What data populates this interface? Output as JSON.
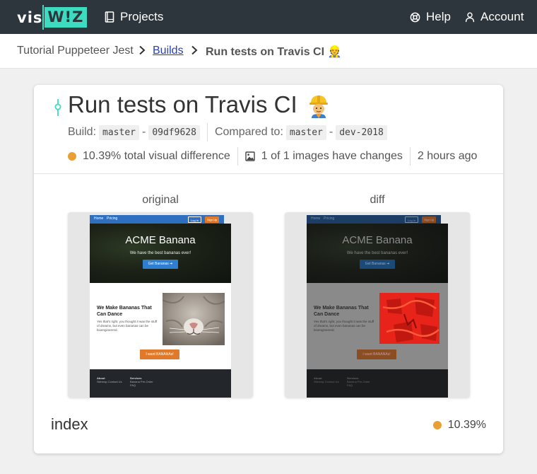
{
  "brand": {
    "vis": "vis",
    "wiz": "W!Z",
    "accent": "#3ddbc0",
    "nav_bg": "#2d363d"
  },
  "nav": {
    "projects_label": "Projects",
    "projects_icon": "book-icon",
    "help_label": "Help",
    "help_icon": "lifebuoy-icon",
    "account_label": "Account",
    "account_icon": "user-icon"
  },
  "breadcrumb": {
    "project": "Tutorial Puppeteer Jest",
    "separator": "›",
    "builds": "Builds",
    "current": "Run tests on Travis CI 👷"
  },
  "build": {
    "title": "Run tests on Travis CI",
    "title_emoji": "construction-worker-emoji",
    "build_label": "Build:",
    "build_branch": "master",
    "build_commit": "09df9628",
    "compared_label": "Compared to:",
    "compared_branch": "master",
    "compared_ref": "dev-2018",
    "dash": "-",
    "visual_difference": "10.39% total visual difference",
    "images_changed": "1 of 1 images have changes",
    "time_ago": "2 hours ago",
    "status_color": "#e8a033"
  },
  "comparison": {
    "original_label": "original",
    "diff_label": "diff",
    "screenshot": {
      "nav_items": [
        "Home",
        "Pricing"
      ],
      "login": "Log In",
      "signup": "Sign Up",
      "hero_title": "ACME Banana",
      "hero_subtitle": "We have the best bananas ever!",
      "hero_button": "Get Bananas ➔",
      "heading": "We Make Bananas That Can Dance",
      "paragraph": "Yes that's right, you thought it was the stuff of dreams, but even bananas can be bioengineered.",
      "cta": "I want BANANAs!",
      "footer_about": "About",
      "footer_about_links": "Sitemap Contact Us",
      "footer_services": "Services",
      "footer_services_links": "Banana Pre-Order FAQ"
    }
  },
  "screen": {
    "name": "index",
    "difference": "10.39%"
  }
}
